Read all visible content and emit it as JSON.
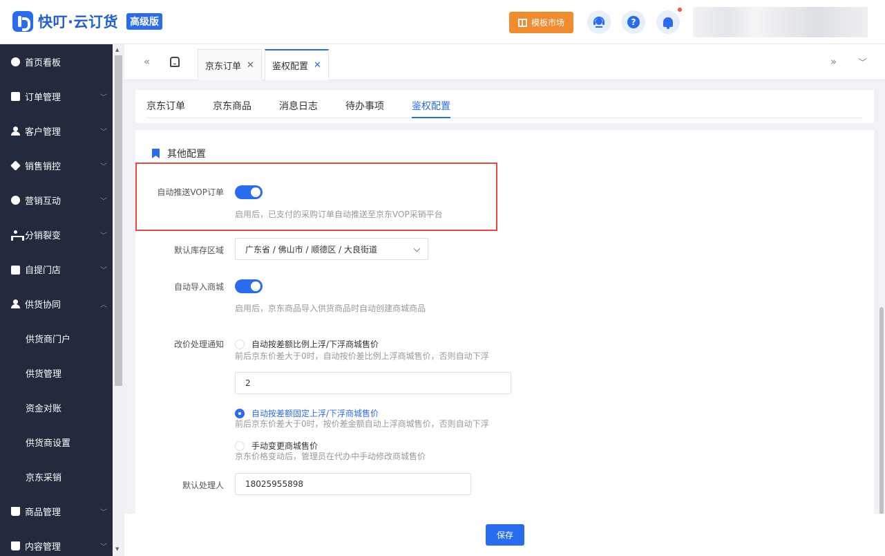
{
  "header": {
    "brand": "快叮·云订货",
    "edition": "高级版",
    "template_market": "模板市场",
    "help_glyph": "?",
    "colors": {
      "accent": "#2a6cf0",
      "orange": "#f08b2e",
      "alert": "#f5533d"
    }
  },
  "sidebar": {
    "items": [
      {
        "label": "首页看板",
        "icon": "dashboard-icon"
      },
      {
        "label": "订单管理",
        "icon": "clipboard-icon"
      },
      {
        "label": "客户管理",
        "icon": "user-icon"
      },
      {
        "label": "销售销控",
        "icon": "tag-icon"
      },
      {
        "label": "营销互动",
        "icon": "target-icon"
      },
      {
        "label": "分销裂变",
        "icon": "tree-icon"
      },
      {
        "label": "自提门店",
        "icon": "store-icon"
      },
      {
        "label": "供货协同",
        "icon": "supplier-icon"
      },
      {
        "label": "商品管理",
        "icon": "bag-icon"
      },
      {
        "label": "内容管理",
        "icon": "content-icon"
      }
    ],
    "sub_items": [
      {
        "label": "供货商门户"
      },
      {
        "label": "供货管理"
      },
      {
        "label": "资金对账"
      },
      {
        "label": "供货商设置"
      },
      {
        "label": "京东采销"
      }
    ]
  },
  "tabs": [
    {
      "label": "京东订单",
      "close": "✕"
    },
    {
      "label": "鉴权配置",
      "close": "✕"
    }
  ],
  "subtabs": [
    {
      "label": "京东订单"
    },
    {
      "label": "京东商品"
    },
    {
      "label": "消息日志"
    },
    {
      "label": "待办事项"
    },
    {
      "label": "鉴权配置"
    }
  ],
  "form": {
    "section_title": "其他配置",
    "auto_push_vop": {
      "label": "自动推送VOP订单",
      "enabled": true,
      "hint": "启用后，已支付的采购订单自动推送至京东VOP采销平台"
    },
    "default_region": {
      "label": "默认库存区域",
      "value": "广东省 / 佛山市 / 顺德区 / 大良街道"
    },
    "auto_import": {
      "label": "自动导入商城",
      "enabled": true,
      "hint": "启用后，京东商品导入供货商品时自动创建商城商品"
    },
    "price_notice": {
      "label": "改价处理通知",
      "options": [
        {
          "label": "自动按差额比例上浮/下浮商城售价",
          "desc": "前后京东价差大于0时，自动按价差比例上浮商城售价，否则自动下浮",
          "selected": false
        },
        {
          "label": "自动按差额固定上浮/下浮商城售价",
          "desc": "前后京东价差大于0时，按价差金额自动上浮商城售价，否则自动下浮",
          "selected": true
        },
        {
          "label": "手动变更商城售价",
          "desc": "京东价格变动后，管理员在代办中手动修改商城售价",
          "selected": false
        }
      ],
      "ratio_value": "2"
    },
    "default_handler": {
      "label": "默认处理人",
      "value": "18025955898"
    },
    "save_label": "保存"
  }
}
